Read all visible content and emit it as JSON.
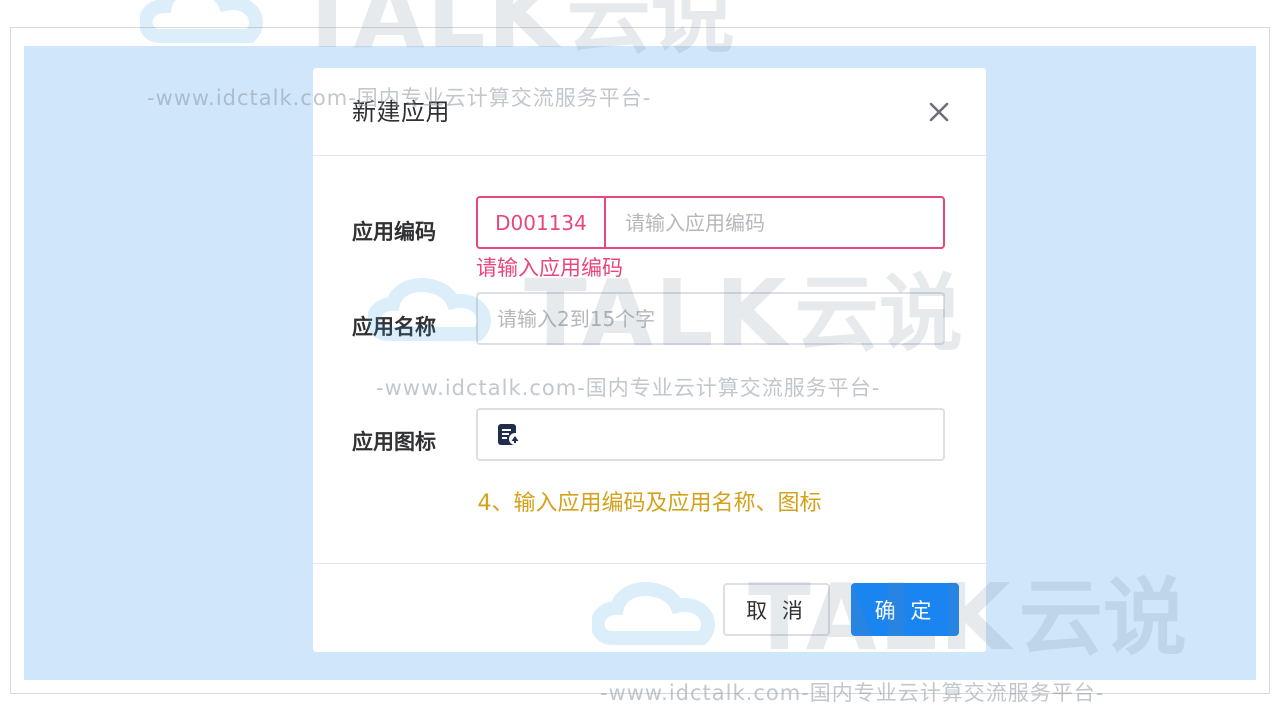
{
  "dialog": {
    "title": "新建应用"
  },
  "form": {
    "code": {
      "label": "应用编码",
      "prefix": "D001134",
      "value": "",
      "placeholder": "请输入应用编码",
      "error": "请输入应用编码"
    },
    "name": {
      "label": "应用名称",
      "value": "",
      "placeholder": "请输入2到15个字"
    },
    "icon": {
      "label": "应用图标",
      "icon_name": "document-edit-icon"
    }
  },
  "annotation": "4、输入应用编码及应用名称、图标",
  "footer": {
    "cancel_label": "取 消",
    "confirm_label": "确 定"
  },
  "watermark": {
    "brand": "TALK",
    "brand_cn": "云说",
    "tagline": "-www.idctalk.com-国内专业云计算交流服务平台-"
  },
  "colors": {
    "backdrop": "#cfe6fb",
    "error": "#e8467c",
    "primary": "#1a85f0",
    "annotation": "#d4a21a"
  }
}
